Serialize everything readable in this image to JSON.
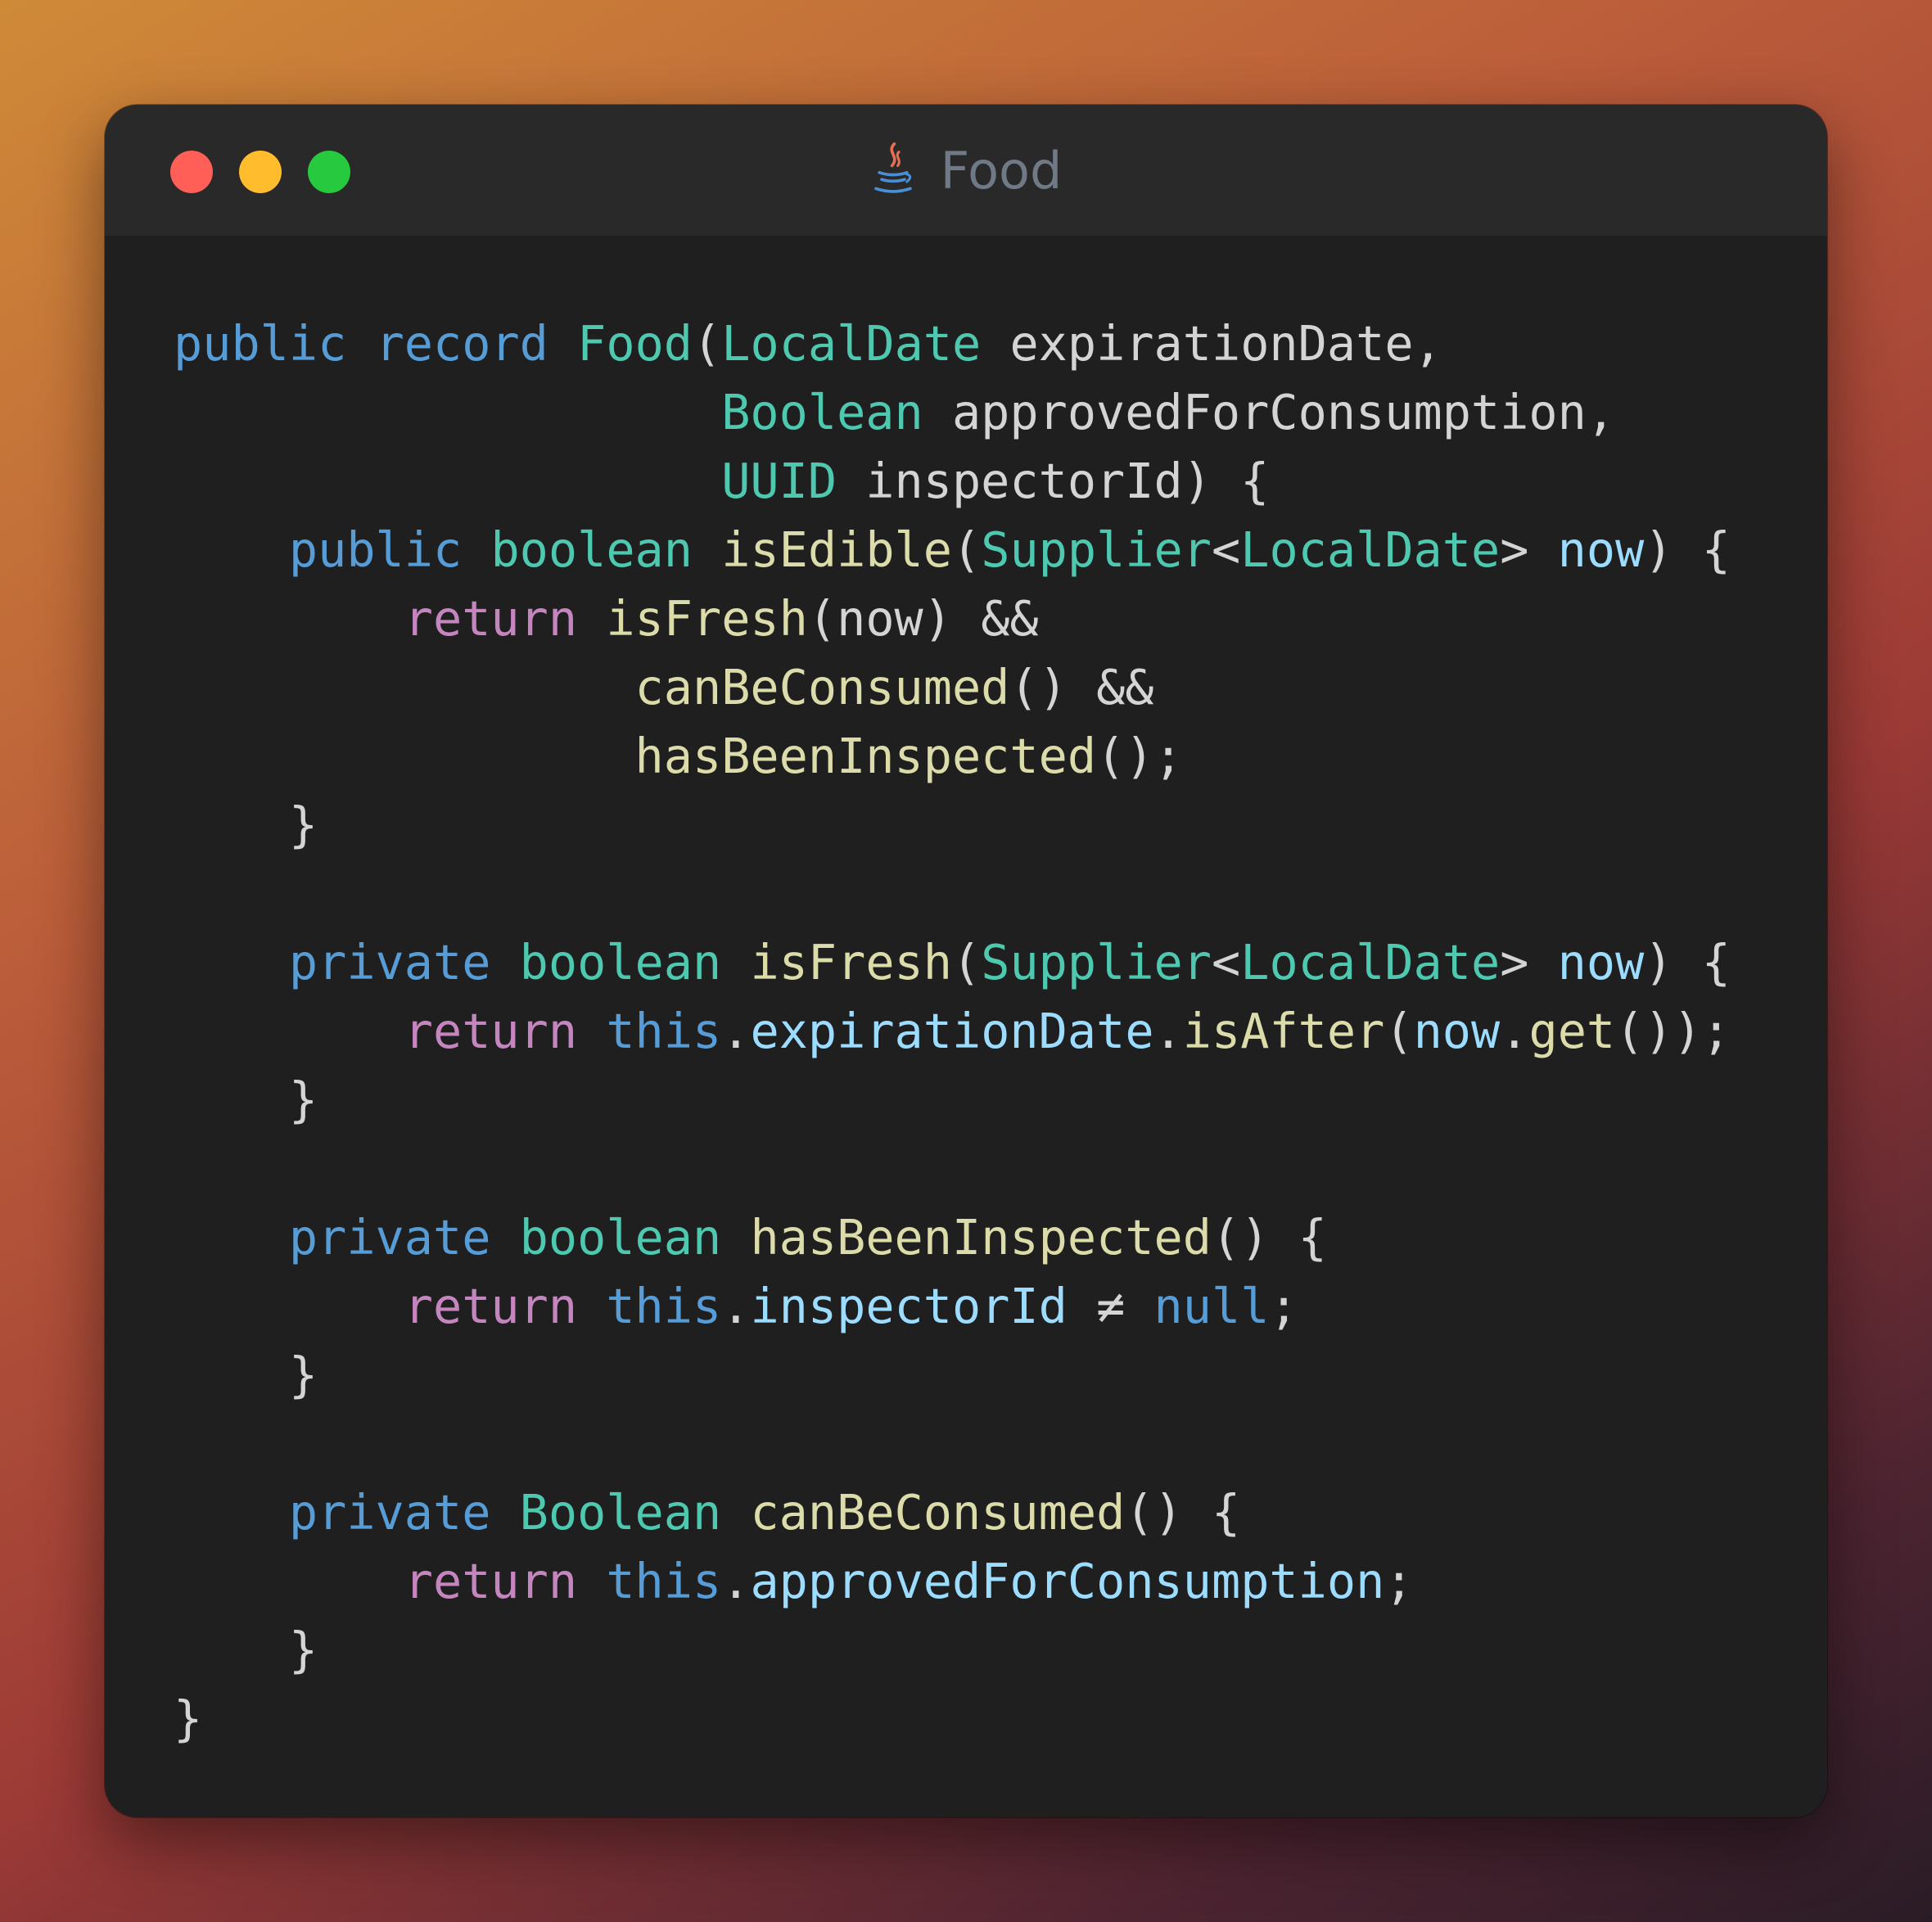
{
  "window": {
    "title": "Food",
    "icon": "java-coffee-icon",
    "traffic_lights": {
      "close_color": "#ff5f56",
      "minimize_color": "#ffbd2e",
      "zoom_color": "#27c93f"
    }
  },
  "code": {
    "language": "java",
    "lines": [
      [
        {
          "text": "public",
          "cls": "kw"
        },
        {
          "text": " ",
          "cls": "pl"
        },
        {
          "text": "record",
          "cls": "kw"
        },
        {
          "text": " ",
          "cls": "pl"
        },
        {
          "text": "Food",
          "cls": "ty"
        },
        {
          "text": "(",
          "cls": "pl"
        },
        {
          "text": "LocalDate",
          "cls": "ty"
        },
        {
          "text": " expirationDate,",
          "cls": "pl"
        }
      ],
      [
        {
          "text": "                   ",
          "cls": "pl"
        },
        {
          "text": "Boolean",
          "cls": "ty"
        },
        {
          "text": " approvedForConsumption,",
          "cls": "pl"
        }
      ],
      [
        {
          "text": "                   ",
          "cls": "pl"
        },
        {
          "text": "UUID",
          "cls": "ty"
        },
        {
          "text": " inspectorId) {",
          "cls": "pl"
        }
      ],
      [
        {
          "text": "    ",
          "cls": "pl"
        },
        {
          "text": "public",
          "cls": "kw"
        },
        {
          "text": " ",
          "cls": "pl"
        },
        {
          "text": "boolean",
          "cls": "ty"
        },
        {
          "text": " ",
          "cls": "pl"
        },
        {
          "text": "isEdible",
          "cls": "fn"
        },
        {
          "text": "(",
          "cls": "pl"
        },
        {
          "text": "Supplier",
          "cls": "ty"
        },
        {
          "text": "<",
          "cls": "pl"
        },
        {
          "text": "LocalDate",
          "cls": "ty"
        },
        {
          "text": "> ",
          "cls": "pl"
        },
        {
          "text": "now",
          "cls": "var"
        },
        {
          "text": ") {",
          "cls": "pl"
        }
      ],
      [
        {
          "text": "        ",
          "cls": "pl"
        },
        {
          "text": "return",
          "cls": "ctl"
        },
        {
          "text": " ",
          "cls": "pl"
        },
        {
          "text": "isFresh",
          "cls": "fn"
        },
        {
          "text": "(now) &&",
          "cls": "pl"
        }
      ],
      [
        {
          "text": "                ",
          "cls": "pl"
        },
        {
          "text": "canBeConsumed",
          "cls": "fn"
        },
        {
          "text": "() &&",
          "cls": "pl"
        }
      ],
      [
        {
          "text": "                ",
          "cls": "pl"
        },
        {
          "text": "hasBeenInspected",
          "cls": "fn"
        },
        {
          "text": "();",
          "cls": "pl"
        }
      ],
      [
        {
          "text": "    }",
          "cls": "pl"
        }
      ],
      [
        {
          "text": "",
          "cls": "pl"
        }
      ],
      [
        {
          "text": "    ",
          "cls": "pl"
        },
        {
          "text": "private",
          "cls": "kw"
        },
        {
          "text": " ",
          "cls": "pl"
        },
        {
          "text": "boolean",
          "cls": "ty"
        },
        {
          "text": " ",
          "cls": "pl"
        },
        {
          "text": "isFresh",
          "cls": "fn"
        },
        {
          "text": "(",
          "cls": "pl"
        },
        {
          "text": "Supplier",
          "cls": "ty"
        },
        {
          "text": "<",
          "cls": "pl"
        },
        {
          "text": "LocalDate",
          "cls": "ty"
        },
        {
          "text": "> ",
          "cls": "pl"
        },
        {
          "text": "now",
          "cls": "var"
        },
        {
          "text": ") {",
          "cls": "pl"
        }
      ],
      [
        {
          "text": "        ",
          "cls": "pl"
        },
        {
          "text": "return",
          "cls": "ctl"
        },
        {
          "text": " ",
          "cls": "pl"
        },
        {
          "text": "this",
          "cls": "kw"
        },
        {
          "text": ".",
          "cls": "pl"
        },
        {
          "text": "expirationDate",
          "cls": "var"
        },
        {
          "text": ".",
          "cls": "pl"
        },
        {
          "text": "isAfter",
          "cls": "fn"
        },
        {
          "text": "(",
          "cls": "pl"
        },
        {
          "text": "now",
          "cls": "var"
        },
        {
          "text": ".",
          "cls": "pl"
        },
        {
          "text": "get",
          "cls": "fn"
        },
        {
          "text": "());",
          "cls": "pl"
        }
      ],
      [
        {
          "text": "    }",
          "cls": "pl"
        }
      ],
      [
        {
          "text": "",
          "cls": "pl"
        }
      ],
      [
        {
          "text": "    ",
          "cls": "pl"
        },
        {
          "text": "private",
          "cls": "kw"
        },
        {
          "text": " ",
          "cls": "pl"
        },
        {
          "text": "boolean",
          "cls": "ty"
        },
        {
          "text": " ",
          "cls": "pl"
        },
        {
          "text": "hasBeenInspected",
          "cls": "fn"
        },
        {
          "text": "() {",
          "cls": "pl"
        }
      ],
      [
        {
          "text": "        ",
          "cls": "pl"
        },
        {
          "text": "return",
          "cls": "ctl"
        },
        {
          "text": " ",
          "cls": "pl"
        },
        {
          "text": "this",
          "cls": "kw"
        },
        {
          "text": ".",
          "cls": "pl"
        },
        {
          "text": "inspectorId",
          "cls": "var"
        },
        {
          "text": " ≠ ",
          "cls": "pl"
        },
        {
          "text": "null",
          "cls": "kw"
        },
        {
          "text": ";",
          "cls": "pl"
        }
      ],
      [
        {
          "text": "    }",
          "cls": "pl"
        }
      ],
      [
        {
          "text": "",
          "cls": "pl"
        }
      ],
      [
        {
          "text": "    ",
          "cls": "pl"
        },
        {
          "text": "private",
          "cls": "kw"
        },
        {
          "text": " ",
          "cls": "pl"
        },
        {
          "text": "Boolean",
          "cls": "ty"
        },
        {
          "text": " ",
          "cls": "pl"
        },
        {
          "text": "canBeConsumed",
          "cls": "fn"
        },
        {
          "text": "() {",
          "cls": "pl"
        }
      ],
      [
        {
          "text": "        ",
          "cls": "pl"
        },
        {
          "text": "return",
          "cls": "ctl"
        },
        {
          "text": " ",
          "cls": "pl"
        },
        {
          "text": "this",
          "cls": "kw"
        },
        {
          "text": ".",
          "cls": "pl"
        },
        {
          "text": "approvedForConsumption",
          "cls": "var"
        },
        {
          "text": ";",
          "cls": "pl"
        }
      ],
      [
        {
          "text": "    }",
          "cls": "pl"
        }
      ],
      [
        {
          "text": "}",
          "cls": "pl"
        }
      ]
    ]
  }
}
